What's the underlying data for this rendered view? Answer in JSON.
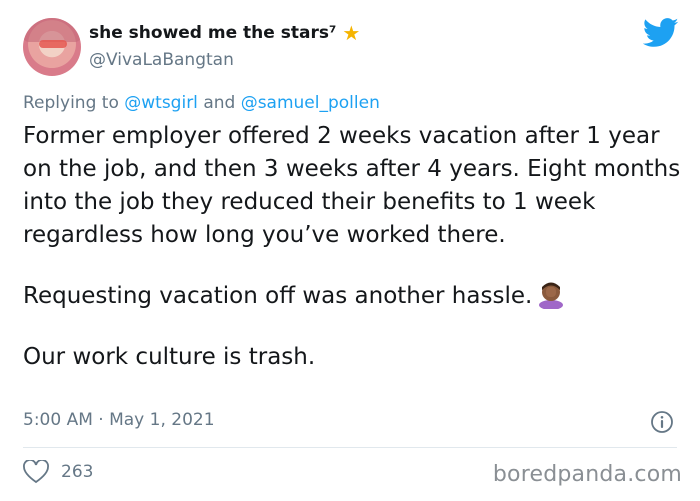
{
  "author": {
    "display_name": "she showed me the stars⁷",
    "handle": "@VivaLaBangtan",
    "badge_icon": "star-icon"
  },
  "reply_to": {
    "prefix": "Replying to",
    "mention_1": "@wtsgirl",
    "conjunction": "and",
    "mention_2": "@samuel_pollen"
  },
  "tweet": {
    "paragraph_1": "Former employer offered 2 weeks vacation after 1 year on the job, and then 3 weeks after 4 years. Eight months into the job they reduced their benefits to 1 week regardless how long you’ve worked there.",
    "paragraph_2": "Requesting vacation off was another hassle.",
    "paragraph_2_emoji": "facepalm-emoji",
    "paragraph_3": "Our work culture is trash."
  },
  "timestamp": "5:00 AM · May 1, 2021",
  "engagement": {
    "likes": "263"
  },
  "watermark": "boredpanda.com",
  "colors": {
    "accent": "#1da1f2",
    "muted": "#657786",
    "star": "#f5b400",
    "text": "#14171a"
  }
}
